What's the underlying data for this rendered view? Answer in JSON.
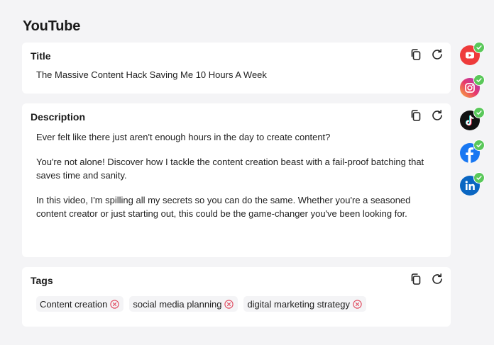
{
  "page": {
    "title": "YouTube"
  },
  "title_card": {
    "label": "Title",
    "value": "The Massive Content Hack Saving Me 10 Hours A Week"
  },
  "description_card": {
    "label": "Description",
    "paragraphs": [
      "Ever felt like there just aren't enough hours in the day to create content?",
      "You're not alone! Discover how I tackle the content creation beast with a fail-proof batching that saves time and sanity.",
      "In this video, I'm spilling all my secrets so you can do the same. Whether you're a seasoned content creator or just starting out, this could be the game-changer you've been looking for."
    ]
  },
  "tags_card": {
    "label": "Tags",
    "tags": [
      "Content creation",
      "social media planning",
      "digital marketing strategy"
    ]
  },
  "card_actions": {
    "copy_icon": "copy-icon",
    "regenerate_icon": "refresh-icon"
  },
  "platforms": [
    {
      "name": "youtube",
      "icon": "youtube-icon",
      "selected": true,
      "color": "#ee3b3b"
    },
    {
      "name": "instagram",
      "icon": "instagram-icon",
      "selected": true,
      "color": "#d9327a"
    },
    {
      "name": "tiktok",
      "icon": "tiktok-icon",
      "selected": true,
      "color": "#111111"
    },
    {
      "name": "facebook",
      "icon": "facebook-icon",
      "selected": true,
      "color": "#1877f2"
    },
    {
      "name": "linkedin",
      "icon": "linkedin-icon",
      "selected": true,
      "color": "#0a66c2"
    }
  ],
  "colors": {
    "check": "#5ac85a",
    "tag_remove": "#e0455a",
    "background": "#f4f4f6"
  }
}
